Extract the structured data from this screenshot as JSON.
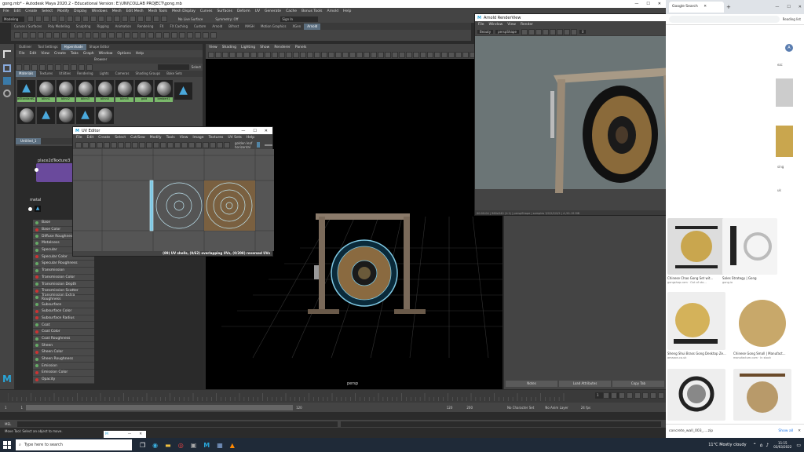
{
  "maya": {
    "title": "gong.mb* - Autodesk Maya 2020.2 - Educational Version: E:\\UNI\\COLLAB PROJECT\\gong.mb",
    "menu": [
      "File",
      "Edit",
      "Create",
      "Select",
      "Modify",
      "Display",
      "Windows",
      "Mesh",
      "Edit Mesh",
      "Mesh Tools",
      "Mesh Display",
      "Curves",
      "Surfaces",
      "Deform",
      "UV",
      "Generate",
      "Cache",
      "Bonus Tools",
      "Arnold",
      "Help"
    ],
    "mode": "Modeling",
    "live_surface": "No Live Surface",
    "symmetry": "Symmetry: Off",
    "sign_in": "Sign In",
    "workspace_label": "Workspace:",
    "workspace": "Maya Classic*",
    "shelf_tabs": [
      "Curves / Surfaces",
      "Poly Modeling",
      "Sculpting",
      "Rigging",
      "Animation",
      "Rendering",
      "FX",
      "FX Caching",
      "Custom",
      "Arnold",
      "Bifrost",
      "MASH",
      "Motion Graphics",
      "XGen",
      "Arnold"
    ],
    "hypershade_tabs": [
      "Outliner",
      "Tool Settings",
      "Hypershade",
      "Shape Editor"
    ],
    "hypershade_menu": [
      "File",
      "Edit",
      "View",
      "Create",
      "Tabs",
      "Graph",
      "Window",
      "Options",
      "Help"
    ],
    "browser_label": "Browser",
    "browser_tabs": [
      "Materials",
      "Textures",
      "Utilities",
      "Rendering",
      "Lights",
      "Cameras",
      "Shading Groups",
      "Bake Sets"
    ],
    "search_label": "Select",
    "swatches": [
      "aiStandardS...",
      "blinn1",
      "blinn2",
      "blinn3",
      "blinn4",
      "blinn5",
      "gold",
      "lambert1"
    ],
    "graph_tab": "Untitled_1",
    "node_place2d": "place2dTexture3",
    "node_metal": "metal",
    "attributes": [
      {
        "name": "Base",
        "color": "#6a6"
      },
      {
        "name": "Base Color",
        "color": "#c33"
      },
      {
        "name": "Diffuse Roughness",
        "color": "#6a6"
      },
      {
        "name": "Metalness",
        "color": "#6a6"
      },
      {
        "name": "Specular",
        "color": "#6a6"
      },
      {
        "name": "Specular Color",
        "color": "#c33"
      },
      {
        "name": "Specular Roughness",
        "color": "#6a6"
      },
      {
        "name": "Transmission",
        "color": "#6a6"
      },
      {
        "name": "Transmission Color",
        "color": "#c33"
      },
      {
        "name": "Transmission Depth",
        "color": "#6a6"
      },
      {
        "name": "Transmission Scatter",
        "color": "#c33"
      },
      {
        "name": "Transmission Extra Roughness",
        "color": "#6a6"
      },
      {
        "name": "Subsurface",
        "color": "#6a6"
      },
      {
        "name": "Subsurface Color",
        "color": "#c33"
      },
      {
        "name": "Subsurface Radius",
        "color": "#c33"
      },
      {
        "name": "Coat",
        "color": "#6a6"
      },
      {
        "name": "Coat Color",
        "color": "#c33"
      },
      {
        "name": "Coat Roughness",
        "color": "#6a6"
      },
      {
        "name": "Sheen",
        "color": "#6a6"
      },
      {
        "name": "Sheen Color",
        "color": "#c33"
      },
      {
        "name": "Sheen Roughness",
        "color": "#6a6"
      },
      {
        "name": "Emission",
        "color": "#6a6"
      },
      {
        "name": "Emission Color",
        "color": "#c33"
      },
      {
        "name": "Opacity",
        "color": "#c33"
      }
    ],
    "viewport_menu": [
      "View",
      "Shading",
      "Lighting",
      "Show",
      "Renderer",
      "Panels"
    ],
    "viewport_values": [
      "0.00",
      "1.00"
    ],
    "color_space": "sRGB gamma",
    "camera_label": "persp",
    "panel_buttons": [
      "Notes",
      "Load Attributes",
      "Copy Tab"
    ],
    "timeline": {
      "start": "1",
      "current": "1",
      "end": "120",
      "range_end": "120",
      "max": "200"
    },
    "no_char_set": "No Character Set",
    "no_anim_layer": "No Anim Layer",
    "fps": "24 fps",
    "cmd_label": "MEL",
    "help_line": "Move Tool: Select an object to move."
  },
  "uv_editor": {
    "title": "UV Editor",
    "menu": [
      "File",
      "Edit",
      "Create",
      "Select",
      "Cut/Sew",
      "Modify",
      "Tools",
      "View",
      "Image",
      "Textures",
      "UV Sets",
      "Help"
    ],
    "texture_label": "golden leaf horizontal",
    "status": "(89) UV shells, (0/62) overlapping UVs, (0/208) reversed UVs"
  },
  "render_view": {
    "title": "Arnold RenderView",
    "menu": [
      "File",
      "Window",
      "View",
      "Render"
    ],
    "mode": "Beauty",
    "camera": "perspShape",
    "zoom": "0",
    "status": "00:00:04 | 960x540 (1:1) | perspShape | samples 3/2/2/2/2/2 | 4 /41.19 MB"
  },
  "browser": {
    "tab_label": "Google Search",
    "reading_list": "Reading list",
    "avatar": "A",
    "results": [
      {
        "caption": "Chinese Chao Gong Set wit...",
        "source": "gongshop.com · Out of sto..."
      },
      {
        "caption": "Sales Strategy | Gong",
        "source": "gong.io"
      },
      {
        "caption": "Sheng Shui Brass Gong Desktop Ze...",
        "source": "amazon.co.uk"
      },
      {
        "caption": "Chinese Gong Small | Manufact...",
        "source": "manufactum.com · In stock"
      }
    ],
    "side_fragments": [
      "ezc",
      "A",
      "sing",
      "o",
      "k",
      "uk",
      "go"
    ],
    "download_file": "concrete_wall_003_....zip",
    "show_all": "Show all"
  },
  "taskbar": {
    "search_placeholder": "Type here to search",
    "weather": "11°C  Mostly cloudy",
    "time": "11:15",
    "date": "03/03/2022",
    "floating_label": "M"
  },
  "colors": {
    "maya_bg": "#444444",
    "viewport_bg": "#000000",
    "uv_accent": "#7ec8e3",
    "accent": "#5285a6",
    "node_purple": "#6a4a9c",
    "taskbar": "#1f2a38"
  }
}
